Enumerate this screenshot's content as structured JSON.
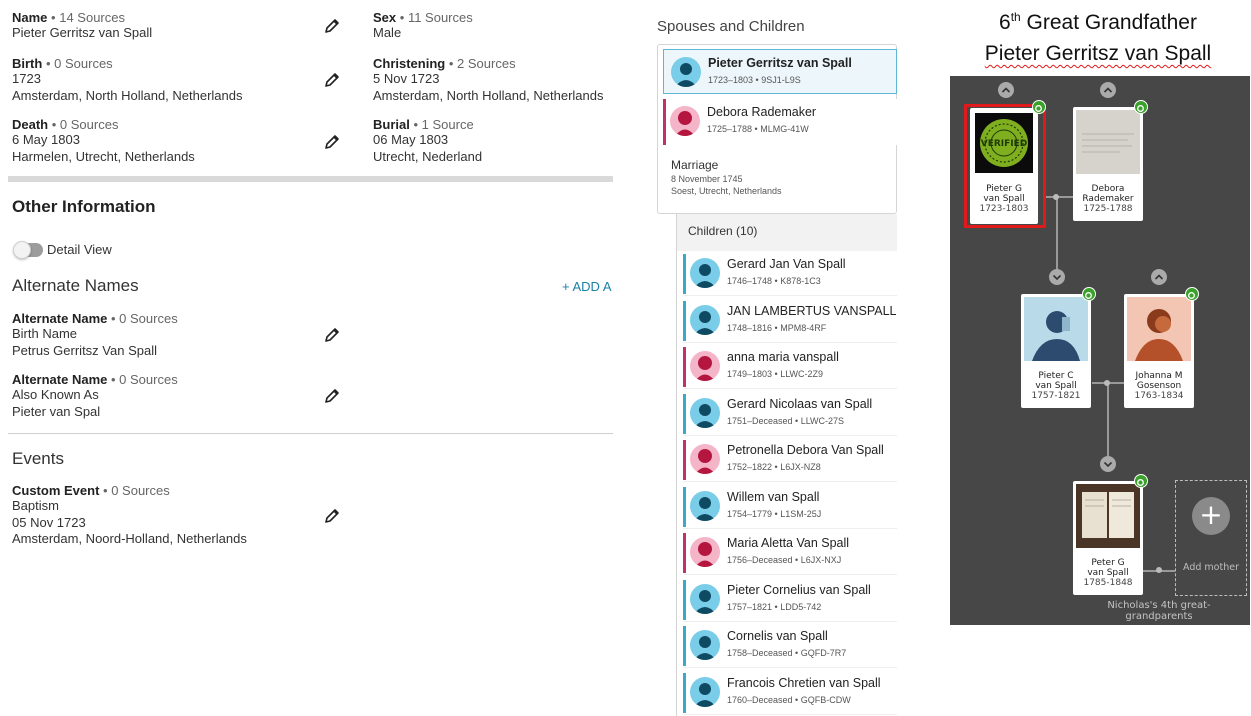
{
  "vitals": [
    {
      "label": "Name",
      "sources": "14 Sources",
      "lines": [
        "Pieter Gerritsz van Spall"
      ]
    },
    {
      "label": "Sex",
      "sources": "11 Sources",
      "lines": [
        "Male"
      ]
    },
    {
      "label": "Birth",
      "sources": "0 Sources",
      "lines": [
        "1723",
        "Amsterdam, North Holland, Netherlands"
      ]
    },
    {
      "label": "Christening",
      "sources": "2 Sources",
      "lines": [
        "5 Nov 1723",
        "Amsterdam, North Holland, Netherlands"
      ]
    },
    {
      "label": "Death",
      "sources": "0 Sources",
      "lines": [
        "6 May 1803",
        "Harmelen, Utrecht, Netherlands"
      ]
    },
    {
      "label": "Burial",
      "sources": "1 Source",
      "lines": [
        "06 May 1803",
        "Utrecht, Nederland"
      ]
    }
  ],
  "other_info": {
    "title": "Other Information",
    "detail_view": "Detail View",
    "alternate_names_title": "Alternate Names",
    "add_label": "+  ADD A",
    "alternate_names": [
      {
        "label": "Alternate Name",
        "sources": "0 Sources",
        "lines": [
          "Birth Name",
          "Petrus Gerritsz Van Spall"
        ]
      },
      {
        "label": "Alternate Name",
        "sources": "0 Sources",
        "lines": [
          "Also Known As",
          "Pieter van Spal"
        ]
      }
    ],
    "events_title": "Events",
    "events": [
      {
        "label": "Custom Event",
        "sources": "0 Sources",
        "lines": [
          "Baptism",
          "05 Nov 1723",
          "Amsterdam, Noord-Holland, Netherlands"
        ]
      }
    ]
  },
  "family": {
    "title": "Spouses and Children",
    "husband": {
      "name": "Pieter Gerritsz van Spall",
      "meta": "1723–1803 • 9SJ1-L9S"
    },
    "wife": {
      "name": "Debora Rademaker",
      "meta": "1725–1788 • MLMG-41W"
    },
    "marriage": {
      "label": "Marriage",
      "date": "8 November 1745",
      "place": "Soest, Utrecht, Netherlands"
    },
    "children_header": "Children (10)",
    "children": [
      {
        "name": "Gerard Jan Van Spall",
        "meta": "1746–1748 • K878-1C3",
        "sex": "male"
      },
      {
        "name": "JAN LAMBERTUS VANSPALL",
        "meta": "1748–1816 • MPM8-4RF",
        "sex": "male"
      },
      {
        "name": "anna maria vanspall",
        "meta": "1749–1803 • LLWC-2Z9",
        "sex": "female"
      },
      {
        "name": "Gerard Nicolaas van Spall",
        "meta": "1751–Deceased • LLWC-27S",
        "sex": "male"
      },
      {
        "name": "Petronella Debora Van Spall",
        "meta": "1752–1822 • L6JX-NZ8",
        "sex": "female"
      },
      {
        "name": "Willem van Spall",
        "meta": "1754–1779 • L1SM-25J",
        "sex": "male"
      },
      {
        "name": "Maria Aletta Van Spall",
        "meta": "1756–Deceased • L6JX-NXJ",
        "sex": "female"
      },
      {
        "name": "Pieter Cornelius van Spall",
        "meta": "1757–1821 • LDD5-742",
        "sex": "male"
      },
      {
        "name": "Cornelis van Spall",
        "meta": "1758–Deceased • GQFD-7R7",
        "sex": "male"
      },
      {
        "name": "Francois Chretien van Spall",
        "meta": "1760–Deceased • GQFB-CDW",
        "sex": "male"
      }
    ]
  },
  "tree": {
    "title_ordinal": "6",
    "title_sup": "th",
    "title_rest": " Great Grandfather",
    "title_name": "Pieter Gerritsz van Spall",
    "gen1": [
      {
        "name1": "Pieter G",
        "name2": "van Spall",
        "dates": "1723-1803"
      },
      {
        "name1": "Debora",
        "name2": "Rademaker",
        "dates": "1725-1788"
      }
    ],
    "gen2": [
      {
        "name1": "Pieter C",
        "name2": "van Spall",
        "dates": "1757-1821"
      },
      {
        "name1": "Johanna M",
        "name2": "Gosenson",
        "dates": "1763-1834"
      }
    ],
    "gen3": {
      "name1": "Peter G",
      "name2": "van Spall",
      "dates": "1785-1848"
    },
    "add_mother": "Add mother",
    "caption_line1": "Nicholas's 4th great-",
    "caption_line2": "grandparents",
    "badge_text": "VERIFIED"
  },
  "colors": {
    "male_bar": "#3aa9c9",
    "female_bar": "#c0326a",
    "male_bg": "#79cde8",
    "female_bg": "#f5b5c9",
    "tree_bg": "#474747",
    "highlight_red": "#e0191b",
    "badge_green": "#3aa12a"
  }
}
